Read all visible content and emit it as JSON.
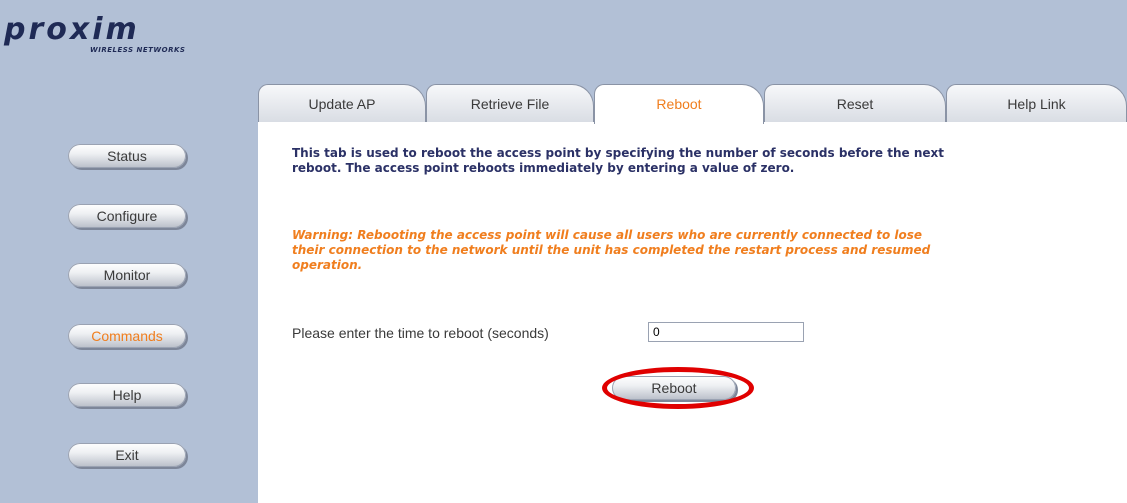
{
  "logo": {
    "wordmark": "proxim",
    "tagline": "WIRELESS NETWORKS"
  },
  "sidebar": {
    "items": [
      {
        "label": "Status"
      },
      {
        "label": "Configure"
      },
      {
        "label": "Monitor"
      },
      {
        "label": "Commands"
      },
      {
        "label": "Help"
      },
      {
        "label": "Exit"
      }
    ],
    "active": "Commands"
  },
  "tabs": [
    {
      "label": "Update AP"
    },
    {
      "label": "Retrieve File"
    },
    {
      "label": "Reboot"
    },
    {
      "label": "Reset"
    },
    {
      "label": "Help Link"
    }
  ],
  "active_tab": "Reboot",
  "content": {
    "description": "This tab is used to reboot the access point by specifying the number of seconds before the next reboot. The access point reboots immediately by entering a value of zero.",
    "warning": "Warning: Rebooting the access point will cause all users who are currently connected to lose their connection to the network until the unit has completed the restart process and resumed operation.",
    "reboot_time_label": "Please enter the time to reboot (seconds)",
    "reboot_time_value": "0",
    "reboot_button": "Reboot"
  },
  "colors": {
    "accent": "#f07e1e",
    "highlight": "#e00000",
    "frame": "#b2c0d6"
  }
}
